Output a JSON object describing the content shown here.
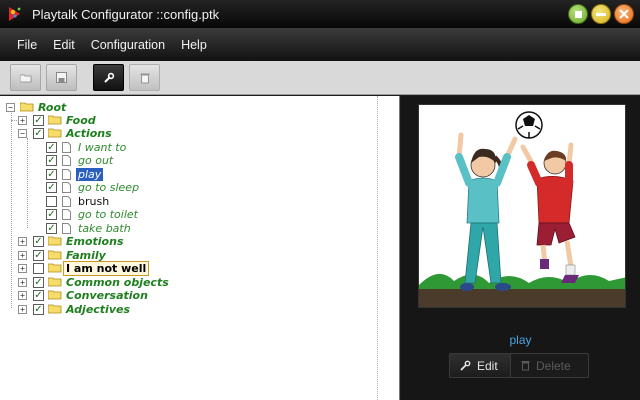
{
  "window": {
    "title": "Playtalk Configurator ::config.ptk"
  },
  "menu": [
    {
      "label": "File"
    },
    {
      "label": "Edit"
    },
    {
      "label": "Configuration"
    },
    {
      "label": "Help"
    }
  ],
  "toolbar": {
    "buttons": [
      {
        "icon": "open-folder-icon",
        "state": "normal"
      },
      {
        "icon": "save-icon",
        "state": "normal"
      },
      {
        "icon": "wrench-icon",
        "state": "active"
      },
      {
        "icon": "trash-icon",
        "state": "disabled"
      }
    ]
  },
  "tree": {
    "root": {
      "label": "Root"
    },
    "groups": [
      {
        "label": "Food",
        "checked": true,
        "expanded": false
      },
      {
        "label": "Actions",
        "checked": true,
        "expanded": true,
        "items": [
          {
            "label": "I want to",
            "checked": true
          },
          {
            "label": "go out",
            "checked": true
          },
          {
            "label": "play",
            "checked": true,
            "selected": true
          },
          {
            "label": "go to sleep",
            "checked": true
          },
          {
            "label": "brush",
            "checked": false
          },
          {
            "label": "go to toilet",
            "checked": true
          },
          {
            "label": "take bath",
            "checked": true
          }
        ]
      },
      {
        "label": "Emotions",
        "checked": true,
        "expanded": false
      },
      {
        "label": "Family",
        "checked": true,
        "expanded": false
      },
      {
        "label": "I am not well",
        "checked": false,
        "expanded": false,
        "editing": true
      },
      {
        "label": "Common objects",
        "checked": true,
        "expanded": false
      },
      {
        "label": "Conversation",
        "checked": true,
        "expanded": false
      },
      {
        "label": "Adjectives",
        "checked": true,
        "expanded": false
      }
    ]
  },
  "preview": {
    "caption": "play",
    "edit_label": "Edit",
    "delete_label": "Delete"
  }
}
